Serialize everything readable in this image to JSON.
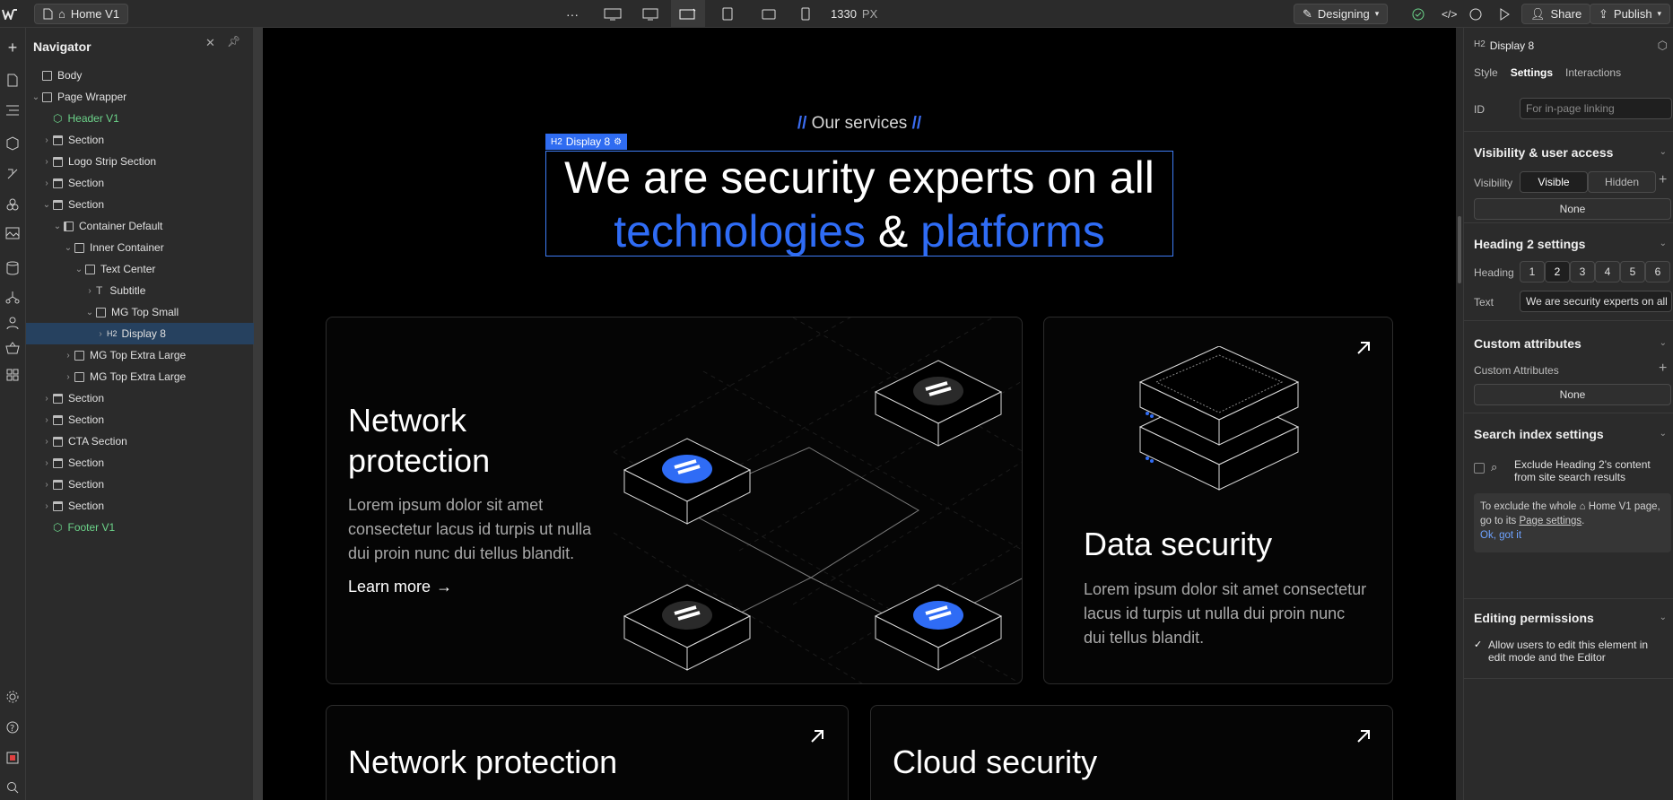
{
  "topbar": {
    "page_name": "Home V1",
    "more": "···",
    "width_value": "1330",
    "width_unit": "PX",
    "mode": "Designing",
    "share": "Share",
    "publish": "Publish"
  },
  "navigator": {
    "title": "Navigator",
    "items": [
      {
        "label": "Body",
        "depth": 0,
        "caret": "",
        "kind": "box"
      },
      {
        "label": "Page Wrapper",
        "depth": 0,
        "caret": "v",
        "kind": "box"
      },
      {
        "label": "Header V1",
        "depth": 1,
        "caret": "",
        "kind": "component",
        "green": true
      },
      {
        "label": "Section",
        "depth": 1,
        "caret": ">",
        "kind": "section"
      },
      {
        "label": "Logo Strip Section",
        "depth": 1,
        "caret": ">",
        "kind": "section"
      },
      {
        "label": "Section",
        "depth": 1,
        "caret": ">",
        "kind": "section"
      },
      {
        "label": "Section",
        "depth": 1,
        "caret": "v",
        "kind": "section"
      },
      {
        "label": "Container Default",
        "depth": 2,
        "caret": "v",
        "kind": "container"
      },
      {
        "label": "Inner Container",
        "depth": 3,
        "caret": "v",
        "kind": "box"
      },
      {
        "label": "Text Center",
        "depth": 4,
        "caret": "v",
        "kind": "box"
      },
      {
        "label": "Subtitle",
        "depth": 5,
        "caret": ">",
        "kind": "text"
      },
      {
        "label": "MG Top Small",
        "depth": 5,
        "caret": "v",
        "kind": "box"
      },
      {
        "label": "Display 8",
        "depth": 6,
        "caret": ">",
        "kind": "h2",
        "selected": true
      },
      {
        "label": "MG Top Extra Large",
        "depth": 3,
        "caret": ">",
        "kind": "box"
      },
      {
        "label": "MG Top Extra Large",
        "depth": 3,
        "caret": ">",
        "kind": "box"
      },
      {
        "label": "Section",
        "depth": 1,
        "caret": ">",
        "kind": "section"
      },
      {
        "label": "Section",
        "depth": 1,
        "caret": ">",
        "kind": "section"
      },
      {
        "label": "CTA Section",
        "depth": 1,
        "caret": ">",
        "kind": "section"
      },
      {
        "label": "Section",
        "depth": 1,
        "caret": ">",
        "kind": "section"
      },
      {
        "label": "Section",
        "depth": 1,
        "caret": ">",
        "kind": "section"
      },
      {
        "label": "Section",
        "depth": 1,
        "caret": ">",
        "kind": "section"
      },
      {
        "label": "Footer V1",
        "depth": 1,
        "caret": "",
        "kind": "component",
        "green": true
      }
    ]
  },
  "canvas": {
    "subtitle_slash": "//",
    "subtitle": "Our services",
    "selection_tag": "Display 8",
    "tag_prefix": "H2",
    "heading_line1": "We are security experts on all",
    "heading_blue1": "technologies",
    "heading_amp": "&",
    "heading_blue2": "platforms",
    "card1": {
      "title_line1": "Network",
      "title_line2": "protection",
      "body": "Lorem ipsum dolor sit amet consectetur lacus id turpis ut nulla dui proin nunc dui tellus blandit.",
      "link": "Learn more"
    },
    "card2": {
      "title": "Data security",
      "body": "Lorem ipsum dolor sit amet consectetur lacus id turpis ut nulla dui proin nunc dui tellus blandit."
    },
    "card3": {
      "title": "Network protection"
    },
    "card4": {
      "title": "Cloud security"
    }
  },
  "right_panel": {
    "element_tag": "H2",
    "element_name": "Display 8",
    "tabs": [
      "Style",
      "Settings",
      "Interactions"
    ],
    "active_tab": "Settings",
    "id_label": "ID",
    "id_placeholder": "For in-page linking",
    "visibility_title": "Visibility & user access",
    "visibility_label": "Visibility",
    "visible": "Visible",
    "hidden": "Hidden",
    "none1": "None",
    "heading_settings_title": "Heading 2 settings",
    "heading_label": "Heading",
    "heading_levels": [
      "1",
      "2",
      "3",
      "4",
      "5",
      "6"
    ],
    "text_label": "Text",
    "text_value": "We are security experts on all",
    "custom_attr_title": "Custom attributes",
    "custom_attr_label": "Custom Attributes",
    "none2": "None",
    "search_title": "Search index settings",
    "search_text": "Exclude Heading 2's content from site search results",
    "note_pre": "To exclude the whole",
    "note_page": "Home V1",
    "note_mid": "page, go to its",
    "note_link": "Page settings",
    "ok": "Ok, got it",
    "perm_title": "Editing permissions",
    "perm_text": "Allow users to edit this element in edit mode and the Editor"
  },
  "colors": {
    "accent": "#2f6cf5",
    "green": "#6cd48a",
    "selected": "#26415f"
  }
}
